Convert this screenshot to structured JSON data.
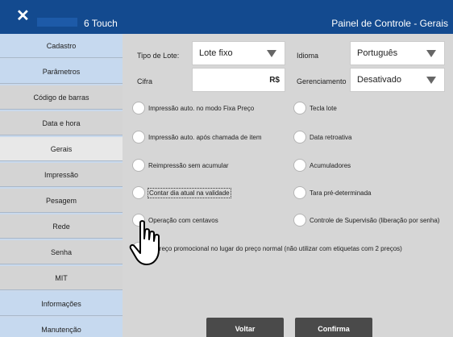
{
  "window": {
    "close_symbol": "✕",
    "app_title": "6 Touch",
    "panel_title": "Painel de Controle - Gerais"
  },
  "sidebar": {
    "items": [
      {
        "label": "Cadastro"
      },
      {
        "label": "Parâmetros"
      },
      {
        "label": "Código de barras"
      },
      {
        "label": "Data e hora"
      },
      {
        "label": "Gerais",
        "active": true
      },
      {
        "label": "Impressão"
      },
      {
        "label": "Pesagem"
      },
      {
        "label": "Rede"
      },
      {
        "label": "Senha"
      },
      {
        "label": "MIT"
      },
      {
        "label": "Informações"
      },
      {
        "label": "Manutenção"
      }
    ]
  },
  "form": {
    "tipo_lote_label": "Tipo de Lote:",
    "tipo_lote_value": "Lote fixo",
    "idioma_label": "Idioma",
    "idioma_value": "Português",
    "cifra_label": "Cifra",
    "cifra_value": "",
    "cifra_suffix": "R$",
    "gerenciamento_label": "Gerenciamento",
    "gerenciamento_value": "Desativado"
  },
  "options": {
    "imp_fixa": "Impressão auto. no modo Fixa Preço",
    "tecla_lote": "Tecla lote",
    "imp_chamada": "Impressão auto. após chamada de item",
    "data_retroativa": "Data retroativa",
    "reimpressao": "Reimpressão sem acumular",
    "acumuladores": "Acumuladores",
    "contar_dia": "Contar dia atual na validade",
    "tara": "Tara pré-determinada",
    "centavos": "Operação com centavos",
    "supervisao": "Controle de Supervisão (liberação por senha)",
    "preco_promo": "ar preço promocional no lugar do preço normal (não utilizar com etiquetas com 2 preços)"
  },
  "buttons": {
    "voltar": "Voltar",
    "confirma": "Confirma"
  },
  "colors": {
    "titlebar": "#134a8f",
    "sidebar_blue": "#c6d9ef",
    "sidebar_gray": "#d4d4d4",
    "button_dark": "#4a4a4a"
  }
}
